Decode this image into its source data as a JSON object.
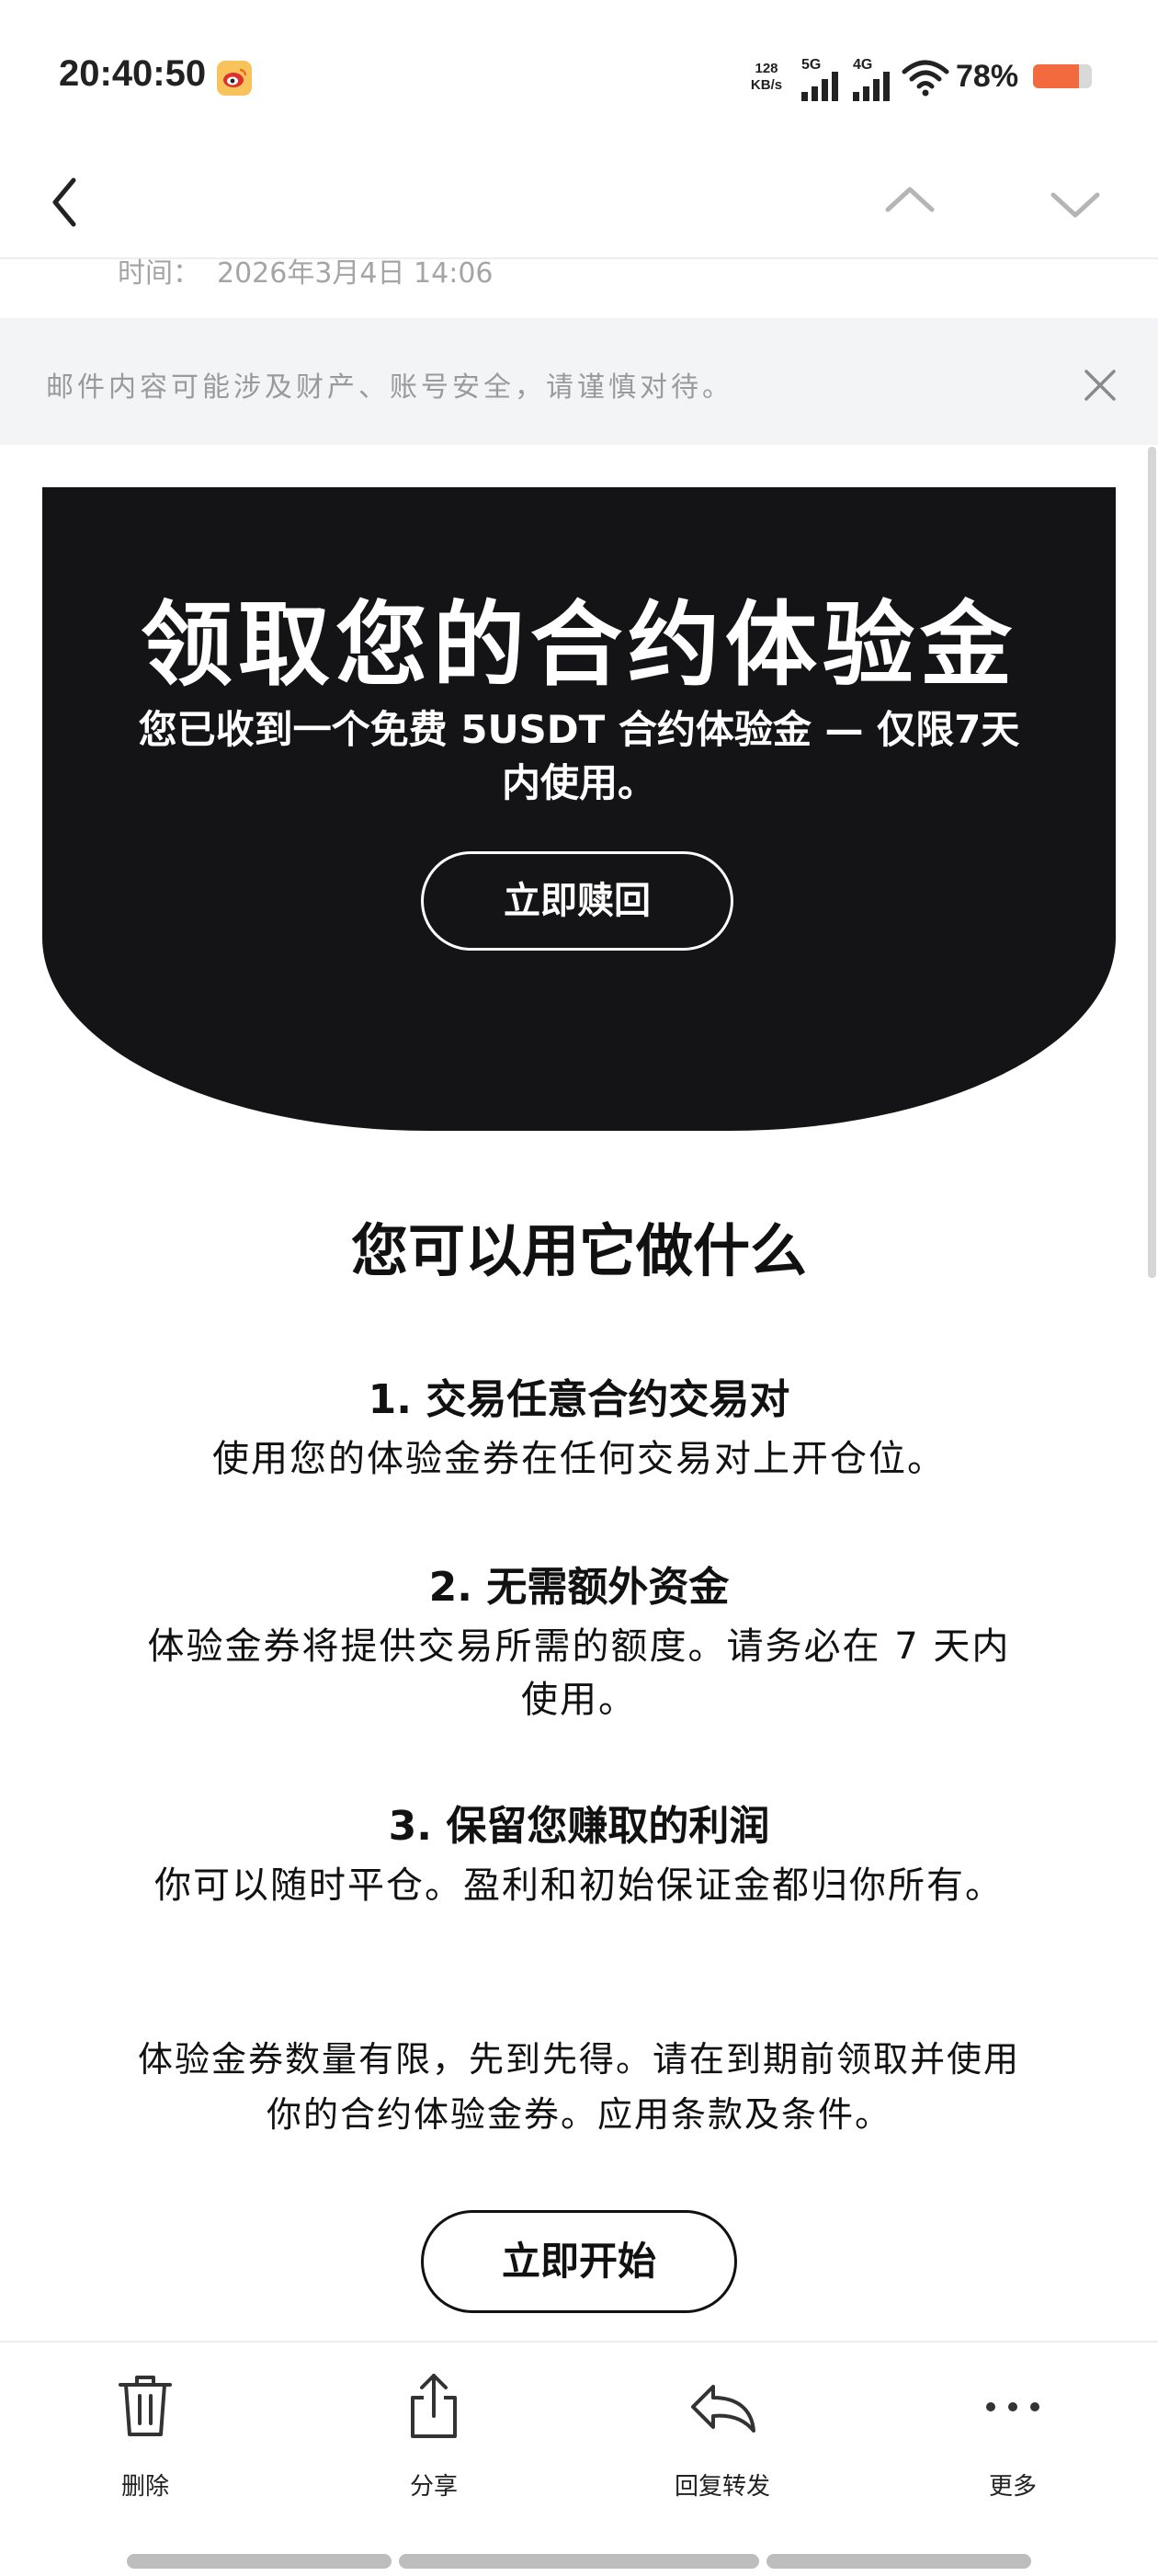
{
  "status_bar": {
    "time": "20:40:50",
    "net_speed_value": "128",
    "net_speed_unit": "KB/s",
    "signal_1_label": "5G",
    "signal_2_label": "4G",
    "battery_percent": "78%",
    "battery_level": 0.78,
    "battery_color": "#f26a3d"
  },
  "mail": {
    "time_label": "时间：",
    "time_value": "2026年3月4日 14:06"
  },
  "warning": {
    "text": "邮件内容可能涉及财产、账号安全，请谨慎对待。"
  },
  "hero": {
    "title": "领取您的合约体验金",
    "subtitle": "您已收到一个免费 5USDT 合约体验金 — 仅限7天内使用。",
    "button": "立即赎回",
    "background": "#141416"
  },
  "body": {
    "section_title": "您可以用它做什么",
    "features": [
      {
        "heading": "1. 交易任意合约交易对",
        "text": "使用您的体验金券在任何交易对上开仓位。"
      },
      {
        "heading": "2. 无需额外资金",
        "text": "体验金券将提供交易所需的额度。请务必在 7 天内使用。"
      },
      {
        "heading": "3. 保留您赚取的利润",
        "text": "你可以随时平仓。盈利和初始保证金都归你所有。"
      }
    ],
    "note": "体验金券数量有限，先到先得。请在到期前领取并使用你的合约体验金券。应用条款及条件。",
    "start_button": "立即开始"
  },
  "toolbar": {
    "delete": {
      "label": "删除",
      "icon": "trash-icon"
    },
    "share": {
      "label": "分享",
      "icon": "share-icon"
    },
    "reply_forward": {
      "label": "回复转发",
      "icon": "reply-icon"
    },
    "more": {
      "label": "更多",
      "icon": "more-icon"
    }
  }
}
